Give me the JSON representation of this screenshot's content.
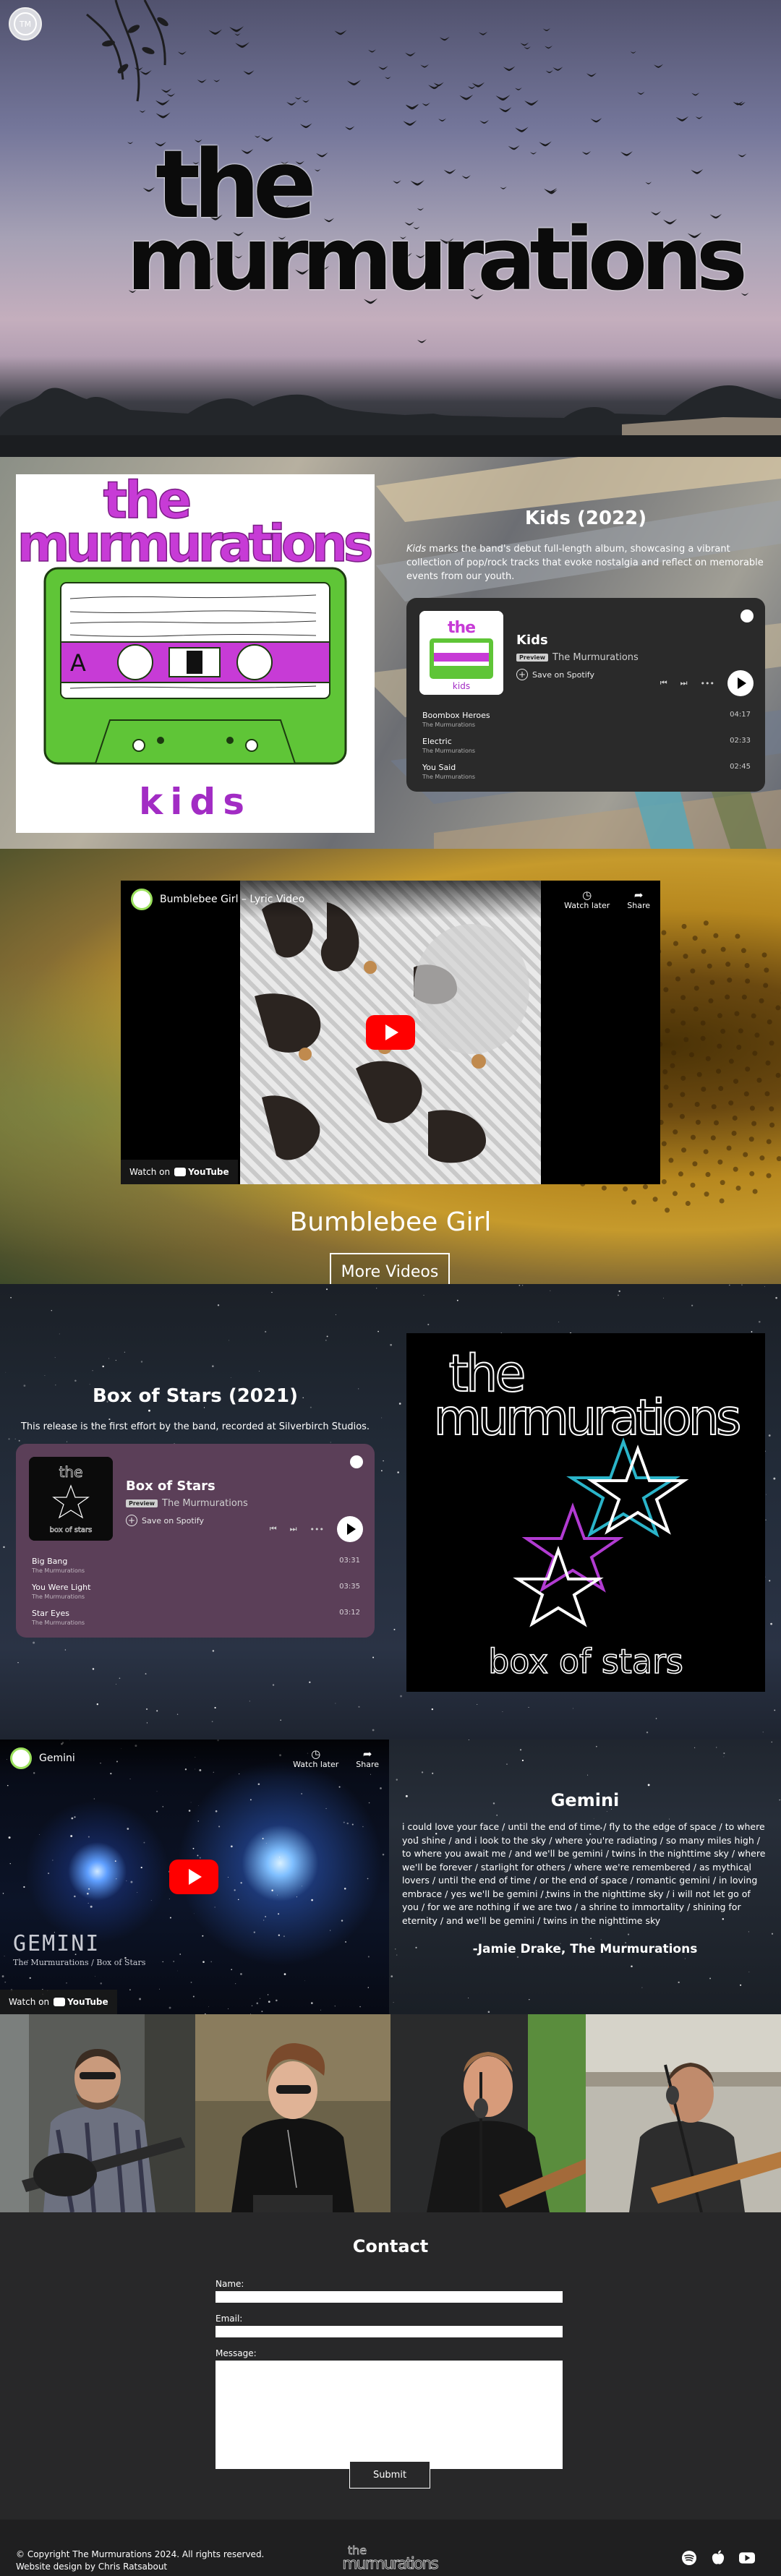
{
  "hero": {
    "badge": "TM",
    "title_line1": "the",
    "title_line2": "murmurations"
  },
  "kids": {
    "cover_line1": "the",
    "cover_line2": "murmurations",
    "cover_word": "kids",
    "cover_side": "A",
    "heading": "Kids (2022)",
    "desc_em": "Kids",
    "desc_rest": " marks the band's debut full-length album, showcasing a vibrant collection of pop/rock tracks that evoke nostalgia and reflect on memorable events from our youth.",
    "spotify": {
      "album": "Kids",
      "preview": "Preview",
      "artist": "The Murmurations",
      "save": "Save on Spotify",
      "art_word": "kids",
      "tracks": [
        {
          "name": "Boombox Heroes",
          "artist": "The Murmurations",
          "duration": "04:17"
        },
        {
          "name": "Electric",
          "artist": "The Murmurations",
          "duration": "02:33"
        },
        {
          "name": "You Said",
          "artist": "The Murmurations",
          "duration": "02:45"
        }
      ],
      "card_color": "#2a2a2a"
    }
  },
  "bee": {
    "video_title": "Bumblebee Girl – Lyric Video",
    "watch_later": "Watch later",
    "share": "Share",
    "watch_on": "Watch on",
    "youtube": "YouTube",
    "title": "Bumblebee Girl",
    "button": "More Videos"
  },
  "box": {
    "heading": "Box of Stars (2021)",
    "desc": "This release is the first effort by the band, recorded at Silverbirch Studios.",
    "cover_line1": "the",
    "cover_line2": "murmurations",
    "cover_caption": "box of stars",
    "spotify": {
      "album": "Box of Stars",
      "preview": "Preview",
      "artist": "The Murmurations",
      "save": "Save on Spotify",
      "tracks": [
        {
          "name": "Big Bang",
          "artist": "The Murmurations",
          "duration": "03:31"
        },
        {
          "name": "You Were Light",
          "artist": "The Murmurations",
          "duration": "03:35"
        },
        {
          "name": "Star Eyes",
          "artist": "The Murmurations",
          "duration": "03:12"
        }
      ],
      "card_color": "#5b3f58"
    }
  },
  "gemini": {
    "video_title": "Gemini",
    "watch_later": "Watch later",
    "share": "Share",
    "watch_on": "Watch on",
    "youtube": "YouTube",
    "screen_big": "GEMINI",
    "screen_small": "The Murmurations / Box of Stars",
    "heading": "Gemini",
    "lyrics": "i could love your face / until the end of time / fly to the edge of space / to where you shine / and i look to the sky / where you're radiating / so many miles high / to where you await me / and we'll be gemini / twins in the nighttime sky / where we'll be forever / starlight for others / where we're remembered / as mythical lovers / until the end of time / or the end of space / romantic gemini / in loving embrace / yes we'll be gemini / twins in the nighttime sky / i will not let go of you / for we are nothing if we are two / a shrine to immortality / shining for eternity / and we'll be gemini / twins in the nighttime sky",
    "attribution": "-Jamie Drake, The Murmurations"
  },
  "contact": {
    "heading": "Contact",
    "name_label": "Name:",
    "email_label": "Email:",
    "message_label": "Message:",
    "submit": "Submit"
  },
  "footer": {
    "copyright": "© Copyright The Murmurations 2024. All rights reserved.",
    "credit": "Website design by Chris Ratsabout",
    "logo_line1": "the",
    "logo_line2": "murmurations"
  },
  "icons": [
    "spotify-icon",
    "apple-icon",
    "youtube-icon",
    "play-icon",
    "share-icon",
    "clock-icon",
    "plus-icon"
  ]
}
